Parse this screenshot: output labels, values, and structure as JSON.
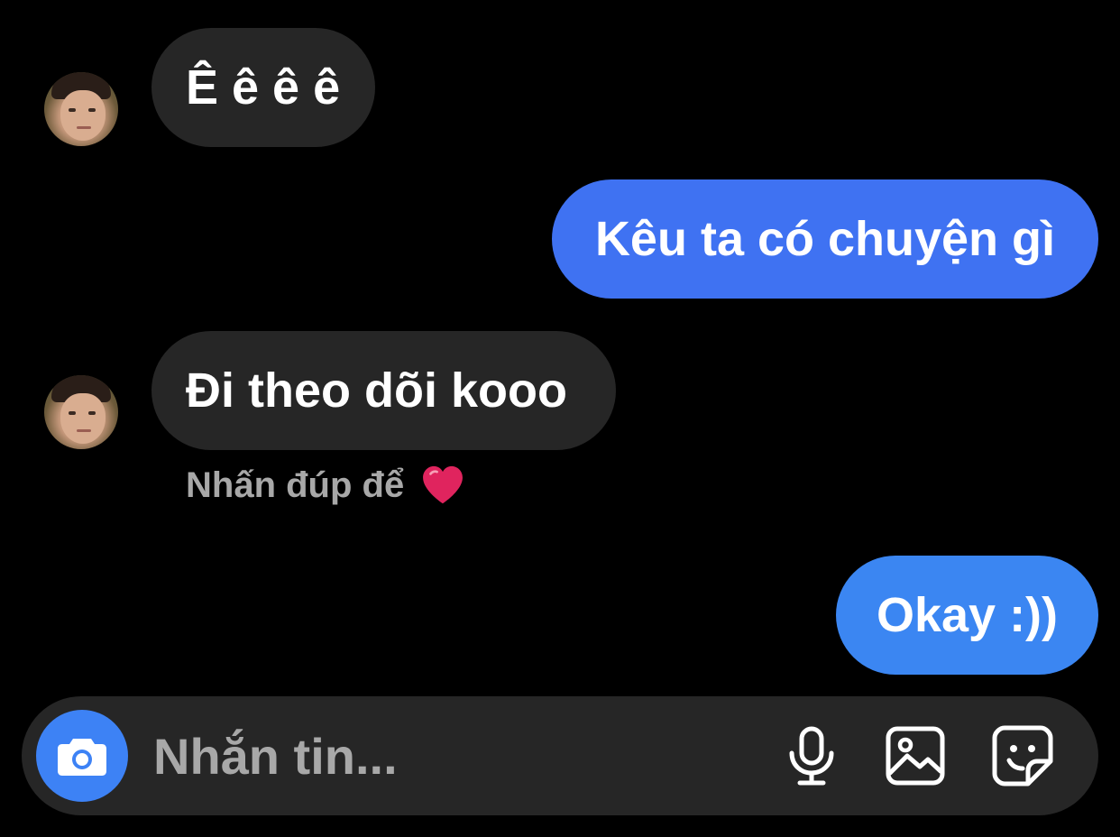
{
  "colors": {
    "background": "#000000",
    "incoming_bubble": "#262626",
    "outgoing_bubble_blue": "#3f6ff0",
    "outgoing_bubble_blue_light": "#3b82f0",
    "hint_text": "#a8a8a8",
    "heart": "#e0245e",
    "camera_button": "#3d82f5"
  },
  "messages": [
    {
      "direction": "incoming",
      "text": "Ê ê ê ê",
      "avatar": true
    },
    {
      "direction": "outgoing",
      "text": "Kêu ta có chuyện gì"
    },
    {
      "direction": "incoming",
      "text": "Đi theo dõi kooo",
      "avatar": true
    },
    {
      "direction": "outgoing",
      "text": "Okay :))"
    }
  ],
  "hint": {
    "text": "Nhấn đúp để",
    "icon": "heart-icon"
  },
  "composer": {
    "placeholder": "Nhắn tin...",
    "camera_icon": "camera-icon",
    "mic_icon": "microphone-icon",
    "gallery_icon": "image-icon",
    "sticker_icon": "sticker-icon"
  }
}
